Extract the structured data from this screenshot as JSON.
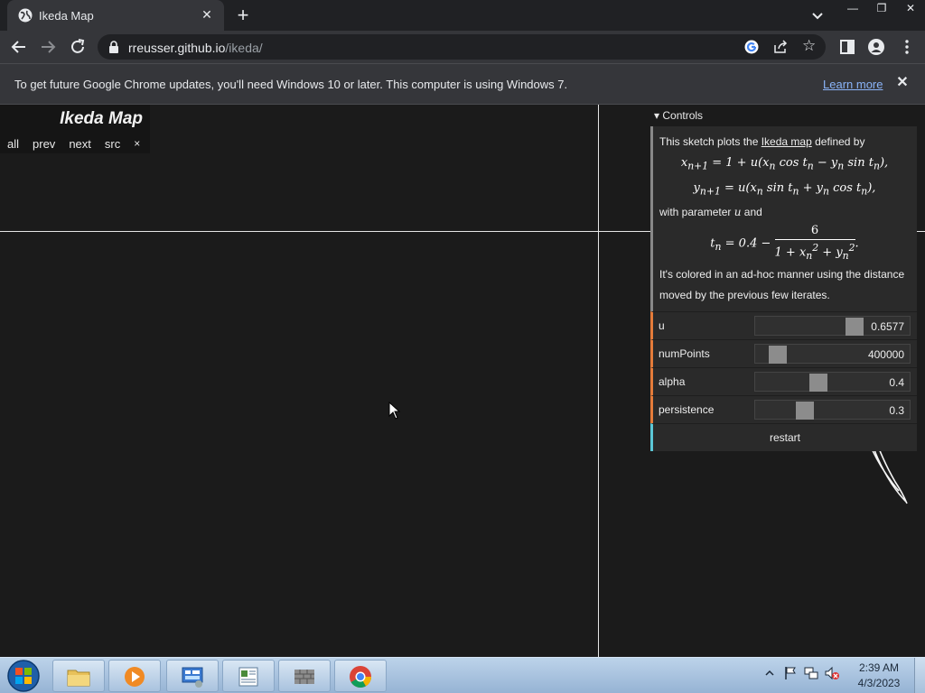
{
  "browser": {
    "tab_title": "Ikeda Map",
    "url_host": "rreusser.github.io",
    "url_path": "/ikeda/",
    "window_controls": [
      "—",
      "❐",
      "✕"
    ]
  },
  "infobar": {
    "message": "To get future Google Chrome updates, you'll need Windows 10 or later. This computer is using Windows 7.",
    "link": "Learn more"
  },
  "sketch": {
    "title": "Ikeda Map",
    "nav": {
      "all": "all",
      "prev": "prev",
      "next": "next",
      "src": "src",
      "close": "×"
    }
  },
  "controls": {
    "header": "▾ Controls",
    "desc_line1_pre": "This sketch plots the ",
    "desc_link": "Ikeda map",
    "desc_line1_post": " defined by",
    "eq1": "x",
    "desc_line2": "with parameter ",
    "param": "u",
    "desc_line2_post": " and",
    "desc_line3": "It's colored in an ad-hoc manner using the distance moved by the previous few iterates.",
    "sliders": [
      {
        "label": "u",
        "value": "0.6577",
        "fraction": 0.66
      },
      {
        "label": "numPoints",
        "value": "400000",
        "fraction": 0.1
      },
      {
        "label": "alpha",
        "value": "0.4",
        "fraction": 0.4
      },
      {
        "label": "persistence",
        "value": "0.3",
        "fraction": 0.3
      }
    ],
    "button": "restart"
  },
  "taskbar": {
    "time": "2:39 AM",
    "date": "4/3/2023"
  },
  "colors": {
    "accent_slider": "#e47b3a",
    "accent_button": "#5cc8d7",
    "link_blue": "#8ab4f8"
  }
}
